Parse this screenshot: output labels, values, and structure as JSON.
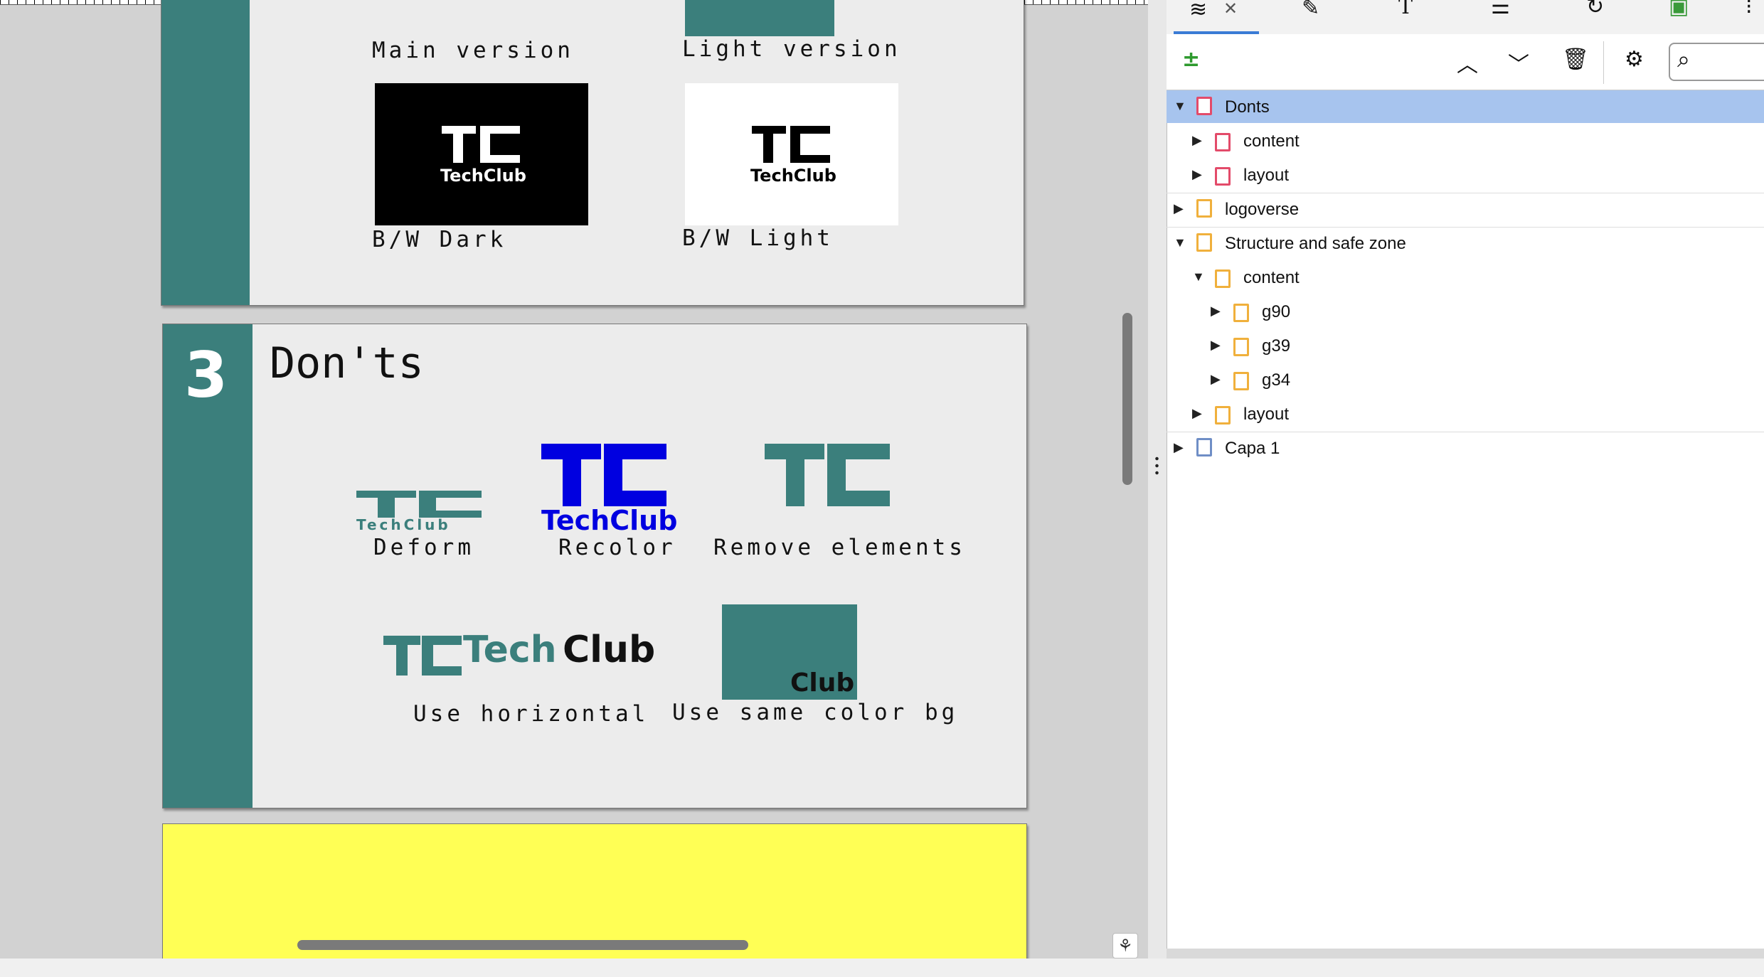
{
  "colors": {
    "teal": "#3b7f7c",
    "recolor_blue": "#0000e0",
    "yellow": "#ffff55",
    "selected_row": "#a7c4ee",
    "red_layer": "#e34b6a",
    "orange_layer": "#f0b03c",
    "blue_layer": "#6f8ec6"
  },
  "canvas": {
    "section_prev": {
      "labels": {
        "main": "Main version",
        "light": "Light version",
        "bw_dark": "B/W Dark",
        "bw_light": "B/W Light"
      },
      "logo_text": "TechClub"
    },
    "section_donts": {
      "number": "3",
      "title": "Don'ts",
      "items": {
        "deform": {
          "label": "Deform",
          "logo_text": "TechClub"
        },
        "recolor": {
          "label": "Recolor",
          "logo_text": "TechClub"
        },
        "remove": {
          "label": "Remove elements"
        },
        "horizontal": {
          "label": "Use horizontal",
          "logo_tech": "Tech",
          "logo_club": "Club"
        },
        "samecolor": {
          "label": "Use same color bg",
          "logo_club": "Club"
        }
      }
    }
  },
  "dock": {
    "tabs": [
      "layers-icon",
      "pen-icon",
      "text-icon",
      "align-icon",
      "transform-icon",
      "image-icon"
    ],
    "layers": [
      {
        "label": "Donts",
        "level": 0,
        "expanded": true,
        "color": "red",
        "selected": true
      },
      {
        "label": "content",
        "level": 1,
        "expanded": false,
        "color": "red"
      },
      {
        "label": "layout",
        "level": 1,
        "expanded": false,
        "color": "red"
      },
      {
        "label": "logoverse",
        "level": 0,
        "expanded": false,
        "color": "orange"
      },
      {
        "label": "Structure and safe zone",
        "level": 0,
        "expanded": true,
        "color": "orange"
      },
      {
        "label": "content",
        "level": 1,
        "expanded": true,
        "color": "orange"
      },
      {
        "label": "g90",
        "level": 2,
        "expanded": false,
        "color": "orange"
      },
      {
        "label": "g39",
        "level": 2,
        "expanded": false,
        "color": "orange"
      },
      {
        "label": "g34",
        "level": 2,
        "expanded": false,
        "color": "orange"
      },
      {
        "label": "layout",
        "level": 1,
        "expanded": false,
        "color": "orange"
      },
      {
        "label": "Capa 1",
        "level": 0,
        "expanded": false,
        "color": "blue"
      }
    ]
  }
}
